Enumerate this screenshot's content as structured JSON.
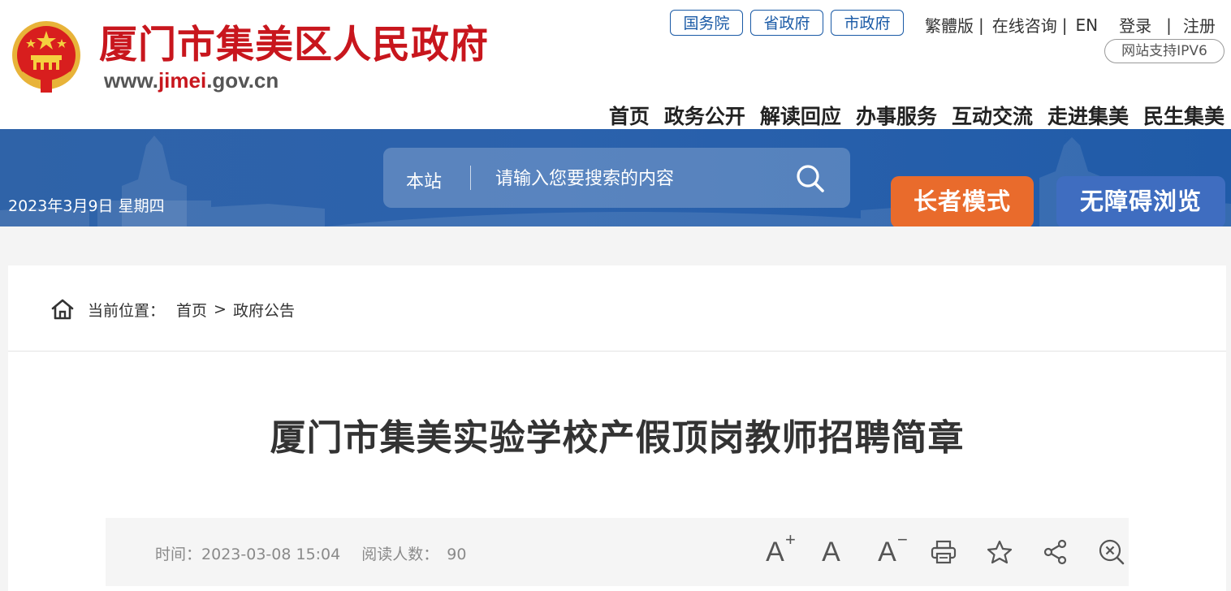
{
  "header": {
    "site_name": "厦门市集美区人民政府",
    "site_url_prefix": "www.",
    "site_url_highlight": "jimei",
    "site_url_suffix": ".gov.cn",
    "gov_links": [
      "国务院",
      "省政府",
      "市政府"
    ],
    "util_links": [
      "繁體版",
      "在线咨询",
      "EN",
      "登录",
      "注册"
    ],
    "ipv6_badge": "网站支持IPV6",
    "nav": [
      "首页",
      "政务公开",
      "解读回应",
      "办事服务",
      "互动交流",
      "走进集美",
      "民生集美"
    ]
  },
  "banner": {
    "date": "2023年3月9日 星期四",
    "search_scope": "本站",
    "search_placeholder": "请输入您要搜索的内容",
    "elder_mode_label": "长者模式",
    "accessibility_label": "无障碍浏览"
  },
  "breadcrumb": {
    "prefix": "当前位置：",
    "items": [
      "首页",
      "政府公告"
    ],
    "separator": ">"
  },
  "article": {
    "title": "厦门市集美实验学校产假顶岗教师招聘简章",
    "time_label": "时间：",
    "time_value": "2023-03-08 15:04",
    "views_label": "阅读人数：",
    "views_value": "90"
  },
  "colors": {
    "brand_red": "#c8161d",
    "link_blue": "#1a5aa6",
    "banner_blue": "#2b62ad",
    "elder_orange": "#e96b2c",
    "access_blue": "#3f6dc0"
  },
  "icons": {
    "emblem": "national-emblem-icon",
    "search": "search-icon",
    "home": "home-icon",
    "font_increase": "font-increase-icon",
    "font_reset": "font-reset-icon",
    "font_decrease": "font-decrease-icon",
    "print": "print-icon",
    "favorite": "star-icon",
    "share": "share-icon",
    "close": "close-icon"
  }
}
